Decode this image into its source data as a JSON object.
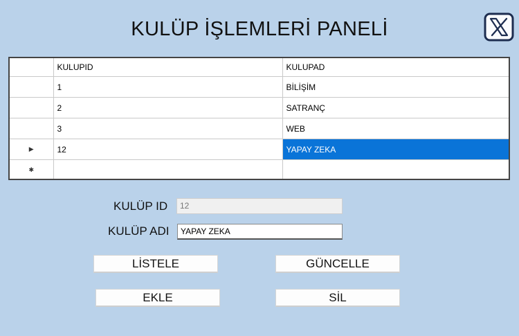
{
  "title": "KULÜP İŞLEMLERİ PANELİ",
  "close_icon": "x-logo-icon",
  "grid": {
    "columns": [
      "KULUPID",
      "KULUPAD"
    ],
    "rows": [
      {
        "id": "1",
        "name": "BİLİŞİM"
      },
      {
        "id": "2",
        "name": "SATRANÇ"
      },
      {
        "id": "3",
        "name": "WEB"
      },
      {
        "id": "12",
        "name": "YAPAY ZEKA"
      }
    ],
    "current_row_marker": "▶",
    "new_row_marker": "✱",
    "selection_color": "#0a74d8"
  },
  "form": {
    "id_label": "KULÜP ID",
    "id_value": "12",
    "name_label": "KULÜP ADI",
    "name_value": "YAPAY ZEKA"
  },
  "buttons": {
    "list": "LİSTELE",
    "update": "GÜNCELLE",
    "add": "EKLE",
    "delete": "SİL"
  }
}
